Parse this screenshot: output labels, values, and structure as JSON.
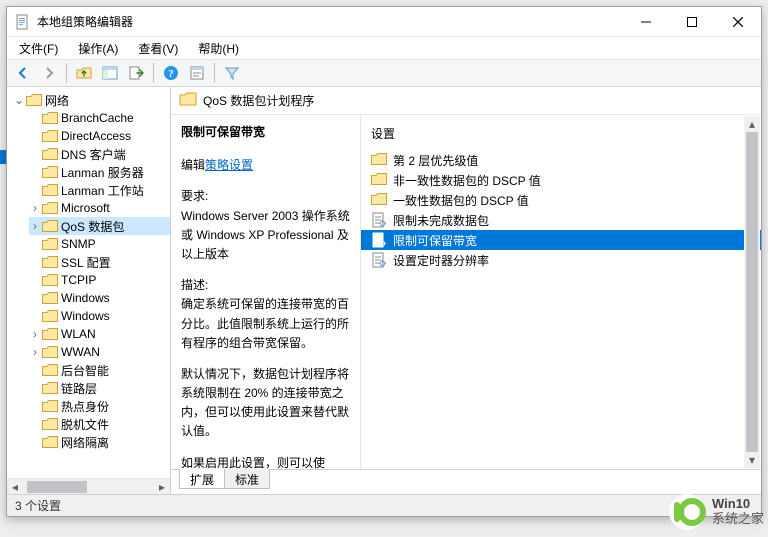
{
  "window": {
    "title": "本地组策略编辑器"
  },
  "menu": {
    "file": "文件(F)",
    "action": "操作(A)",
    "view": "查看(V)",
    "help": "帮助(H)"
  },
  "tree": {
    "root": "网络",
    "items": [
      "BranchCache",
      "DirectAccess",
      "DNS 客户端",
      "Lanman 服务器",
      "Lanman 工作站",
      "Microsoft",
      "QoS 数据包",
      "SNMP",
      "SSL 配置",
      "TCPIP",
      "Windows",
      "Windows",
      "WLAN",
      "WWAN",
      "后台智能",
      "链路层",
      "热点身份",
      "脱机文件",
      "网络隔离"
    ],
    "expandable_indices": [
      5,
      6,
      12,
      13
    ],
    "selected_index": 6
  },
  "header": {
    "title": "QoS 数据包计划程序"
  },
  "description": {
    "selected_title": "限制可保留带宽",
    "edit_prefix": "编辑",
    "edit_link": "策略设置",
    "req_label": "要求:",
    "req_text": "Windows Server 2003 操作系统 或 Windows XP Professional 及以上版本",
    "desc_label": "描述:",
    "desc_text1": "确定系统可保留的连接带宽的百分比。此值限制系统上运行的所有程序的组合带宽保留。",
    "desc_text2": "默认情况下，数据包计划程序将系统限制在 20% 的连接带宽之内，但可以使用此设置来替代默认值。",
    "desc_text3": "如果启用此设置，则可以使用\"带宽限制\"框来调整系统可保留的带宽数量。"
  },
  "list": {
    "col_header": "设置",
    "items": [
      {
        "kind": "folder",
        "label": "第 2 层优先级值"
      },
      {
        "kind": "folder",
        "label": "非一致性数据包的 DSCP 值"
      },
      {
        "kind": "folder",
        "label": "一致性数据包的 DSCP 值"
      },
      {
        "kind": "setting",
        "label": "限制未完成数据包"
      },
      {
        "kind": "setting",
        "label": "限制可保留带宽"
      },
      {
        "kind": "setting",
        "label": "设置定时器分辨率"
      }
    ],
    "selected_index": 4
  },
  "tabs": {
    "extended": "扩展",
    "standard": "标准"
  },
  "status": {
    "text": "3 个设置"
  },
  "watermark": {
    "line1": "Win10",
    "line2": "系统之家"
  }
}
